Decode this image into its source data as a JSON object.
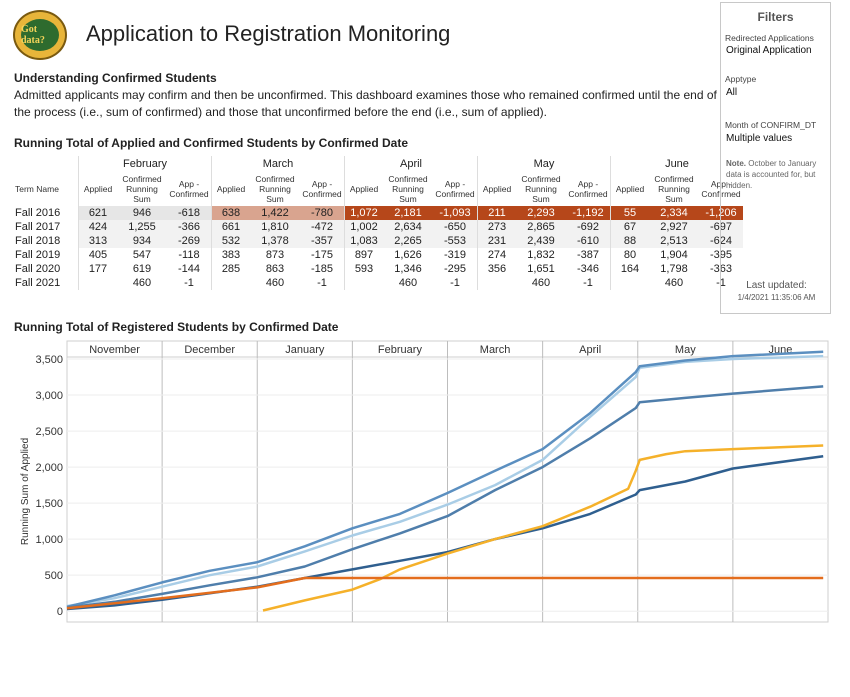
{
  "title": "Application to Registration Monitoring",
  "logo": {
    "top_text": "100% Guaranteed",
    "main_text": "Got data?"
  },
  "section_heading": "Understanding Confirmed Students",
  "description": "Admitted applicants may confirm and then be unconfirmed. This dashboard examines those who remained confirmed until the end of the process (i.e., sum of confirmed) and those that unconfirmed before the end (i.e., sum of applied).",
  "table_title": "Running Total of Applied and Confirmed Students by Confirmed Date",
  "table": {
    "term_header": "Term Name",
    "months": [
      "February",
      "March",
      "April",
      "May",
      "June"
    ],
    "col_headers": [
      "Applied",
      "Confirmed Running Sum",
      "App - Confirmed"
    ],
    "rows": [
      {
        "term": "Fall 2016",
        "cells": [
          [
            "621",
            "946",
            "-618"
          ],
          [
            "638",
            "1,422",
            "-780"
          ],
          [
            "1,072",
            "2,181",
            "-1,093"
          ],
          [
            "211",
            "2,293",
            "-1,192"
          ],
          [
            "55",
            "2,334",
            "-1,206"
          ]
        ]
      },
      {
        "term": "Fall 2017",
        "cells": [
          [
            "424",
            "1,255",
            "-366"
          ],
          [
            "661",
            "1,810",
            "-472"
          ],
          [
            "1,002",
            "2,634",
            "-650"
          ],
          [
            "273",
            "2,865",
            "-692"
          ],
          [
            "67",
            "2,927",
            "-697"
          ]
        ]
      },
      {
        "term": "Fall 2018",
        "cells": [
          [
            "313",
            "934",
            "-269"
          ],
          [
            "532",
            "1,378",
            "-357"
          ],
          [
            "1,083",
            "2,265",
            "-553"
          ],
          [
            "231",
            "2,439",
            "-610"
          ],
          [
            "88",
            "2,513",
            "-624"
          ]
        ]
      },
      {
        "term": "Fall 2019",
        "cells": [
          [
            "405",
            "547",
            "-118"
          ],
          [
            "383",
            "873",
            "-175"
          ],
          [
            "897",
            "1,626",
            "-319"
          ],
          [
            "274",
            "1,832",
            "-387"
          ],
          [
            "80",
            "1,904",
            "-395"
          ]
        ]
      },
      {
        "term": "Fall 2020",
        "cells": [
          [
            "177",
            "619",
            "-144"
          ],
          [
            "285",
            "863",
            "-185"
          ],
          [
            "593",
            "1,346",
            "-295"
          ],
          [
            "356",
            "1,651",
            "-346"
          ],
          [
            "164",
            "1,798",
            "-363"
          ]
        ]
      },
      {
        "term": "Fall 2021",
        "cells": [
          [
            "",
            "460",
            "-1"
          ],
          [
            "",
            "460",
            "-1"
          ],
          [
            "",
            "460",
            "-1"
          ],
          [
            "",
            "460",
            "-1"
          ],
          [
            "",
            "460",
            "-1"
          ]
        ]
      }
    ],
    "highlight_colors": {
      "dark": "#b6471a",
      "medium": "#d9a48f",
      "light": "#e6e6e6"
    }
  },
  "filters": {
    "heading": "Filters",
    "redirected_label": "Redirected Applications",
    "redirected_value": "Original Application",
    "apptype_label": "Apptype",
    "apptype_value": "All",
    "month_label": "Month of CONFIRM_DT",
    "month_value": "Multiple values",
    "note_label": "Note.",
    "note_text": "October to January data is accounted for, but hidden.",
    "last_updated_label": "Last updated:",
    "last_updated_value": "1/4/2021 11:35:06 AM"
  },
  "chart_title": "Running Total of Registered Students by Confirmed Date",
  "chart_data": {
    "type": "line",
    "ylabel": "Running Sum of Applied",
    "xlabel": "",
    "ylim": [
      -150,
      3750
    ],
    "yticks": [
      "0",
      "500",
      "1,000",
      "1,500",
      "2,000",
      "2,500",
      "3,000",
      "3,500"
    ],
    "ytick_values": [
      0,
      500,
      1000,
      1500,
      2000,
      2500,
      3000,
      3500
    ],
    "months": [
      "November",
      "December",
      "January",
      "February",
      "March",
      "April",
      "May",
      "June"
    ],
    "day_ticks": [
      [
        "3",
        "8",
        "13",
        "18",
        "23",
        "28"
      ],
      [
        "3",
        "8",
        "13",
        "18",
        "23",
        "28"
      ],
      [
        "3",
        "8",
        "13",
        "18",
        "23",
        "28"
      ],
      [
        "3",
        "8",
        "13",
        "18",
        "23"
      ],
      [
        "3",
        "8",
        "13",
        "18",
        "23",
        "28"
      ],
      [
        "3",
        "8",
        "13",
        "18",
        "23",
        "28"
      ],
      [
        "3",
        "8",
        "13",
        "18",
        "23",
        "28"
      ],
      [
        "3",
        "8",
        "13",
        "18",
        "23",
        "28"
      ]
    ],
    "grid": true,
    "series": [
      {
        "color": "#a9cde6",
        "points": [
          [
            0,
            70
          ],
          [
            0.5,
            180
          ],
          [
            1,
            340
          ],
          [
            1.5,
            500
          ],
          [
            2,
            620
          ],
          [
            2.5,
            830
          ],
          [
            3,
            1050
          ],
          [
            3.5,
            1240
          ],
          [
            4,
            1480
          ],
          [
            4.5,
            1750
          ],
          [
            5,
            2100
          ],
          [
            5.5,
            2700
          ],
          [
            5.98,
            3250
          ],
          [
            6.02,
            3380
          ],
          [
            6.5,
            3460
          ],
          [
            7,
            3500
          ],
          [
            7.95,
            3540
          ]
        ]
      },
      {
        "color": "#5b8fc0",
        "points": [
          [
            0,
            60
          ],
          [
            0.5,
            220
          ],
          [
            1,
            400
          ],
          [
            1.5,
            560
          ],
          [
            2,
            680
          ],
          [
            2.5,
            900
          ],
          [
            3,
            1150
          ],
          [
            3.5,
            1350
          ],
          [
            4,
            1640
          ],
          [
            4.5,
            1950
          ],
          [
            5,
            2250
          ],
          [
            5.5,
            2750
          ],
          [
            5.98,
            3320
          ],
          [
            6.02,
            3400
          ],
          [
            6.5,
            3480
          ],
          [
            7,
            3540
          ],
          [
            7.95,
            3600
          ]
        ]
      },
      {
        "color": "#4f7eab",
        "points": [
          [
            0,
            50
          ],
          [
            0.5,
            130
          ],
          [
            1,
            240
          ],
          [
            1.5,
            360
          ],
          [
            2,
            470
          ],
          [
            2.5,
            620
          ],
          [
            3,
            860
          ],
          [
            3.5,
            1080
          ],
          [
            4,
            1320
          ],
          [
            4.5,
            1680
          ],
          [
            5,
            2000
          ],
          [
            5.5,
            2400
          ],
          [
            5.98,
            2820
          ],
          [
            6.02,
            2900
          ],
          [
            6.5,
            2960
          ],
          [
            7,
            3020
          ],
          [
            7.95,
            3120
          ]
        ]
      },
      {
        "color": "#2f5f8f",
        "points": [
          [
            0,
            30
          ],
          [
            0.5,
            80
          ],
          [
            1,
            160
          ],
          [
            1.5,
            250
          ],
          [
            2,
            340
          ],
          [
            2.5,
            460
          ],
          [
            3,
            580
          ],
          [
            3.5,
            700
          ],
          [
            4,
            820
          ],
          [
            4.5,
            1000
          ],
          [
            5,
            1150
          ],
          [
            5.5,
            1350
          ],
          [
            5.98,
            1620
          ],
          [
            6.02,
            1680
          ],
          [
            6.5,
            1800
          ],
          [
            7,
            1980
          ],
          [
            7.95,
            2150
          ]
        ]
      },
      {
        "color": "#f5b12a",
        "points": [
          [
            2.06,
            10
          ],
          [
            2.5,
            150
          ],
          [
            3,
            300
          ],
          [
            3.3,
            450
          ],
          [
            3.5,
            580
          ],
          [
            4,
            800
          ],
          [
            4.5,
            1000
          ],
          [
            5,
            1180
          ],
          [
            5.5,
            1450
          ],
          [
            5.9,
            1700
          ],
          [
            5.98,
            1950
          ],
          [
            6.02,
            2100
          ],
          [
            6.3,
            2180
          ],
          [
            6.5,
            2220
          ],
          [
            7,
            2250
          ],
          [
            7.95,
            2300
          ]
        ]
      },
      {
        "color": "#e36d1d",
        "points": [
          [
            0,
            40
          ],
          [
            1,
            180
          ],
          [
            2,
            330
          ],
          [
            2.5,
            460
          ],
          [
            3,
            460
          ],
          [
            4,
            460
          ],
          [
            5,
            460
          ],
          [
            6,
            460
          ],
          [
            7,
            460
          ],
          [
            7.95,
            460
          ]
        ]
      }
    ]
  }
}
